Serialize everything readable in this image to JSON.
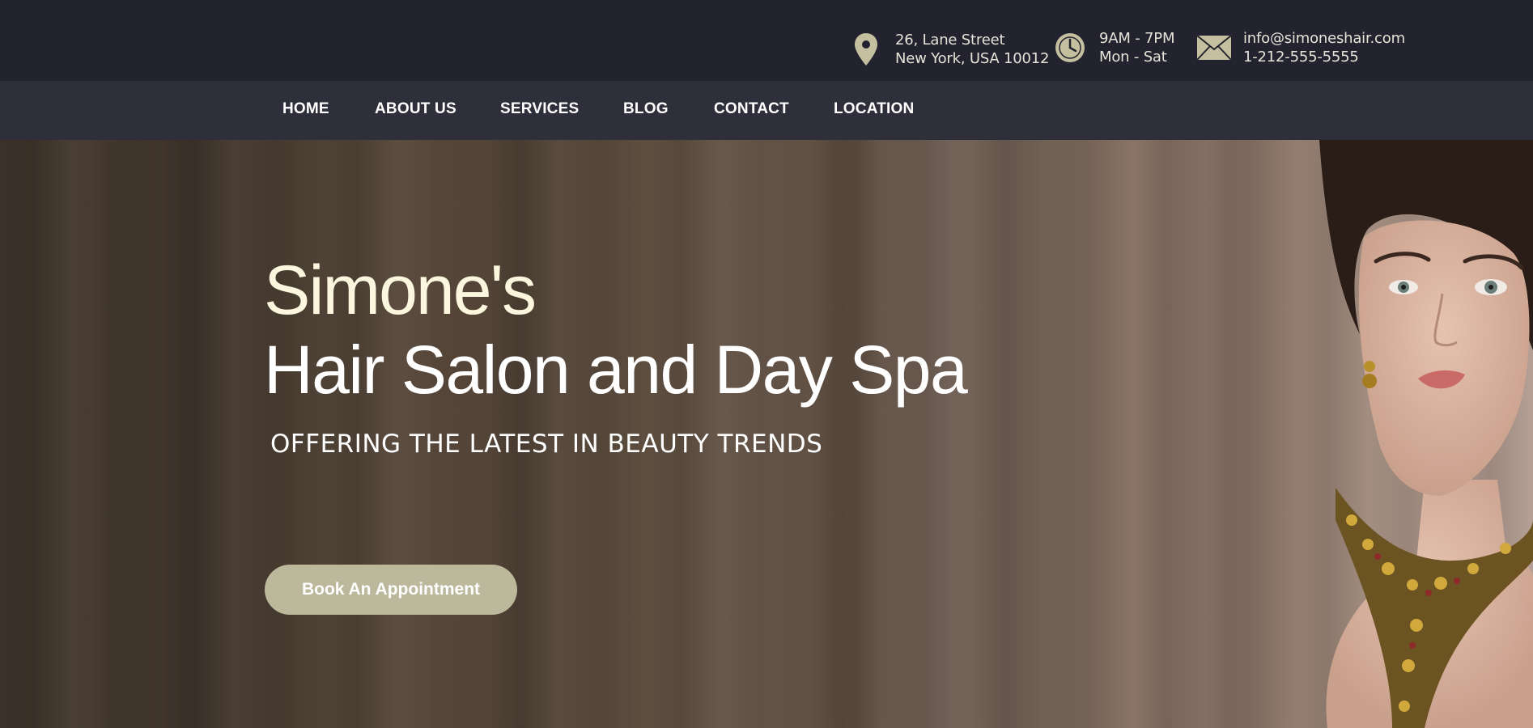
{
  "contact": {
    "address": {
      "icon": "location-pin-icon",
      "line1": "26, Lane Street",
      "line2": "New York, USA 10012"
    },
    "hours": {
      "icon": "clock-icon",
      "line1": "9AM - 7PM",
      "line2": "Mon - Sat"
    },
    "email": {
      "icon": "envelope-icon",
      "line1": "info@simoneshair.com",
      "line2": "1-212-555-5555"
    }
  },
  "nav": {
    "items": [
      {
        "label": "HOME"
      },
      {
        "label": "ABOUT US"
      },
      {
        "label": "SERVICES"
      },
      {
        "label": "BLOG"
      },
      {
        "label": "CONTACT"
      },
      {
        "label": "LOCATION"
      }
    ]
  },
  "hero": {
    "title": "Simone's",
    "subtitle": "Hair Salon and Day Spa",
    "tagline": "OFFERING THE LATEST IN BEAUTY TRENDS",
    "cta_label": "Book An Appointment"
  },
  "colors": {
    "topbar": "#22232e",
    "navbar": "#2e2f3a",
    "accent": "#bcb89c",
    "title_cream": "#fbf6dd"
  }
}
